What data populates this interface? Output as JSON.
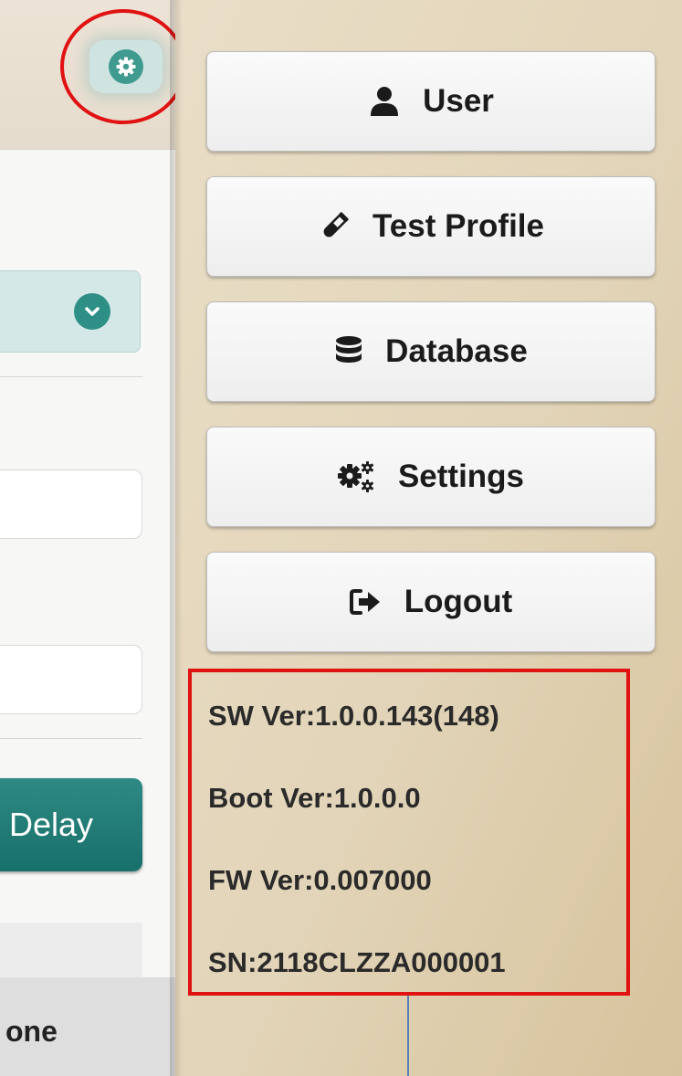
{
  "menu": {
    "items": [
      {
        "label": "User",
        "icon": "user-icon"
      },
      {
        "label": "Test Profile",
        "icon": "test-tube-icon"
      },
      {
        "label": "Database",
        "icon": "database-icon"
      },
      {
        "label": "Settings",
        "icon": "gears-icon"
      },
      {
        "label": "Logout",
        "icon": "logout-icon"
      }
    ]
  },
  "device_info": {
    "sw_ver": "SW Ver:1.0.0.143(148)",
    "boot_ver": "Boot Ver:1.0.0.0",
    "fw_ver": "FW Ver:0.007000",
    "sn": "SN:2118CLZZA000001"
  },
  "left_panel": {
    "delay_label": "Delay",
    "bottom_text": "one"
  },
  "colors": {
    "accent": "#3f9a8f",
    "highlight": "#e01212",
    "menu_bg": "#e2d4b8"
  }
}
